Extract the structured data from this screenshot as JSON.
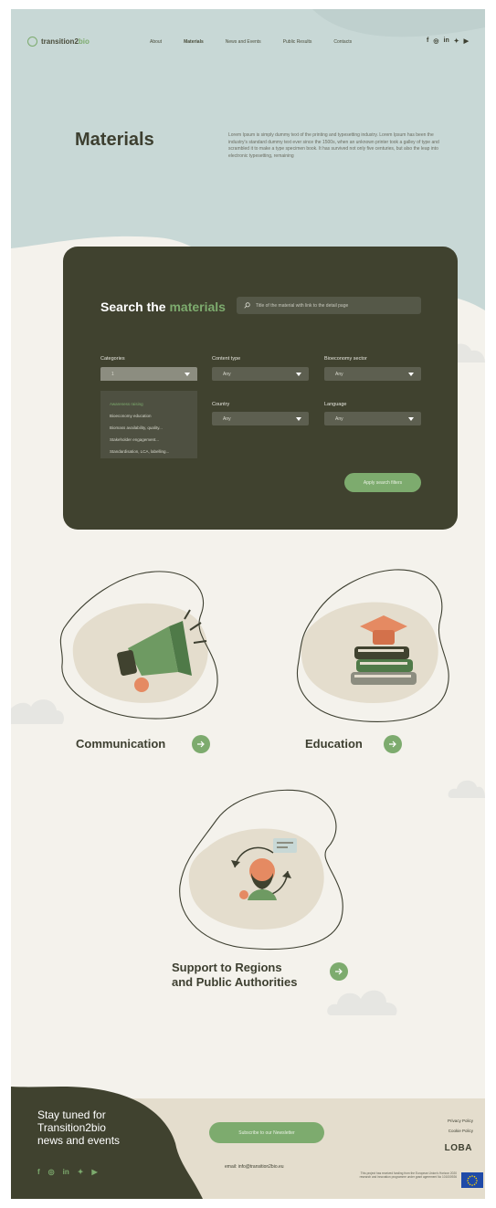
{
  "brand": {
    "name_prefix": "transition2",
    "name_accent": "bio"
  },
  "nav": {
    "links": [
      "About",
      "Materials",
      "News and Events",
      "Public Results",
      "Contacts"
    ],
    "active": "Materials",
    "social": [
      "f",
      "◎",
      "in",
      "✦",
      "▶"
    ]
  },
  "hero": {
    "title": "Materials",
    "description": "Lorem Ipsum is simply dummy text of the printing and typesetting industry. Lorem Ipsum has been the industry's standard dummy text ever since the 1500s, when an unknown printer took a galley of type and scrambled it to make a type specimen book. It has survived not only five centuries, but also the leap into electronic typesetting, remaining"
  },
  "search": {
    "title_prefix": "Search the ",
    "title_accent": "materials",
    "placeholder": "Title of the material with link to the detail page",
    "filters": {
      "categories": {
        "label": "Categories",
        "value": "1"
      },
      "content_type": {
        "label": "Content type",
        "value": "Any"
      },
      "bioeconomy_sector": {
        "label": "Bioeconomy sector",
        "value": "Any"
      },
      "country": {
        "label": "Country",
        "value": "Any"
      },
      "language": {
        "label": "Language",
        "value": "Any"
      }
    },
    "dropdown_items": [
      "Awareness raising",
      "Bioeconomy education",
      "Biomass availability, quality...",
      "Stakeholder engagement...",
      "Standardisation, LCA, labelling..."
    ],
    "apply_label": "Apply search filters"
  },
  "categories": {
    "communication": "Communication",
    "education": "Education",
    "support_line1": "Support to Regions",
    "support_line2": "and Public Authorities"
  },
  "footer": {
    "title_line1": "Stay tuned for",
    "title_line2": "Transition2bio",
    "title_line3": "news and events",
    "subscribe_label": "Subscribe to our Newsletter",
    "email": "email: info@transition2bio.eu",
    "links": [
      "Privacy Policy",
      "Cookie Policy"
    ],
    "logo": "LOBA",
    "eu_disclaimer": "This project has received funding from the European Union's Horizon 2020 research and innovation programme under grant agreement No 101000926",
    "social": [
      "f",
      "◎",
      "in",
      "✦",
      "▶"
    ]
  },
  "colors": {
    "dark": "#40422f",
    "green": "#7dab6e",
    "hero_bg": "#c8d8d6",
    "beige": "#e4ddcd",
    "page_bg": "#f4f2ec"
  }
}
